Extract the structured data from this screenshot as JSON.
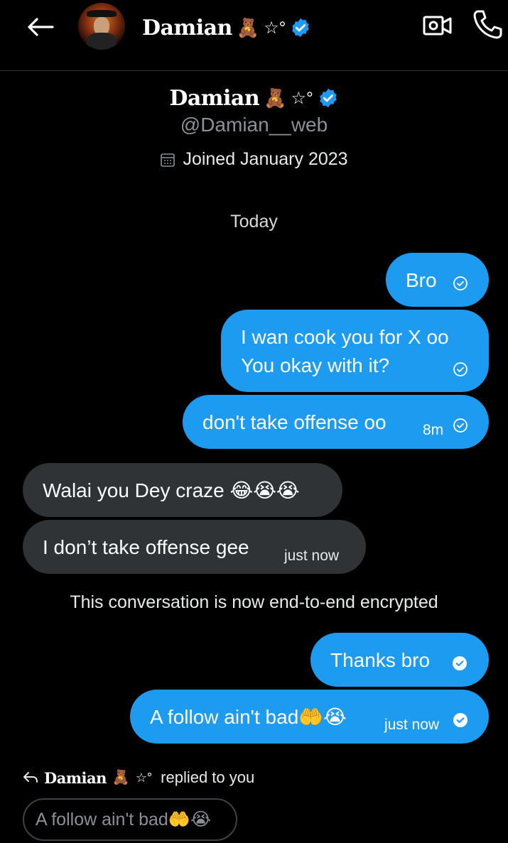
{
  "header": {
    "display_name": "Damian",
    "name_emoji": "🧸",
    "name_star": "☆°"
  },
  "profile": {
    "display_name": "Damian",
    "name_emoji": "🧸",
    "name_star": "☆°",
    "handle": "@Damian__web",
    "joined": "Joined January 2023"
  },
  "date_divider": "Today",
  "messages": [
    {
      "direction": "out",
      "text": "Bro",
      "time": ""
    },
    {
      "direction": "out",
      "line1": "I wan cook you for X oo",
      "line2": "You okay with it?",
      "time": ""
    },
    {
      "direction": "out",
      "text": "don't take offense oo",
      "time": "8m"
    },
    {
      "direction": "in",
      "text": "Walai you Dey craze 😂😭😭",
      "time": ""
    },
    {
      "direction": "in",
      "text": "I don’t take offense gee",
      "time": "just now"
    },
    {
      "direction": "out",
      "text": "Thanks bro",
      "time": ""
    },
    {
      "direction": "out",
      "text": "A follow ain't bad🤲😭",
      "time": "just now"
    }
  ],
  "encryption_notice": "This conversation is now end-to-end encrypted",
  "reply": {
    "name": "Damian",
    "name_emoji": "🧸",
    "name_star": "☆°",
    "suffix": "replied to you",
    "quoted": "A follow ain't bad🤲😭"
  },
  "colors": {
    "accent": "#1d9bf0",
    "incoming_bubble": "#2f3336",
    "background": "#000000",
    "muted_text": "#8b9096"
  }
}
